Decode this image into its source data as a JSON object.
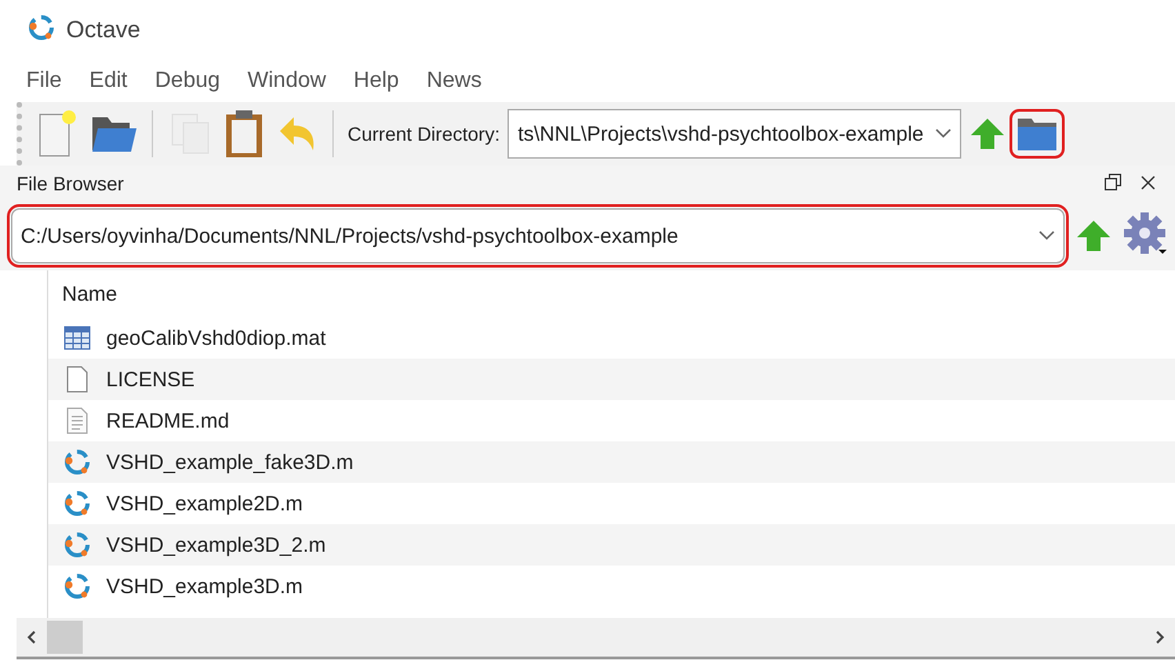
{
  "window": {
    "title": "Octave"
  },
  "menu": [
    "File",
    "Edit",
    "Debug",
    "Window",
    "Help",
    "News"
  ],
  "toolbar": {
    "buttons": [
      {
        "kind": "new",
        "disabled": false
      },
      {
        "kind": "open",
        "disabled": false
      },
      {
        "kind": "sep"
      },
      {
        "kind": "copy",
        "disabled": true
      },
      {
        "kind": "paste",
        "disabled": false
      },
      {
        "kind": "undo",
        "disabled": false
      },
      {
        "kind": "sep"
      }
    ],
    "directory_label": "Current Directory:",
    "directory_value": "ts\\NNL\\Projects\\vshd-psychtoolbox-example",
    "browse_highlighted": true
  },
  "file_browser": {
    "title": "File Browser",
    "path": "C:/Users/oyvinha/Documents/NNL/Projects/vshd-psychtoolbox-example",
    "path_highlighted": true,
    "column": "Name",
    "files": [
      {
        "name": "geoCalibVshd0diop.mat",
        "kind": "data"
      },
      {
        "name": "LICENSE",
        "kind": "blank"
      },
      {
        "name": "README.md",
        "kind": "text"
      },
      {
        "name": "VSHD_example_fake3D.m",
        "kind": "octave"
      },
      {
        "name": "VSHD_example2D.m",
        "kind": "octave"
      },
      {
        "name": "VSHD_example3D_2.m",
        "kind": "octave"
      },
      {
        "name": "VSHD_example3D.m",
        "kind": "octave"
      }
    ]
  }
}
